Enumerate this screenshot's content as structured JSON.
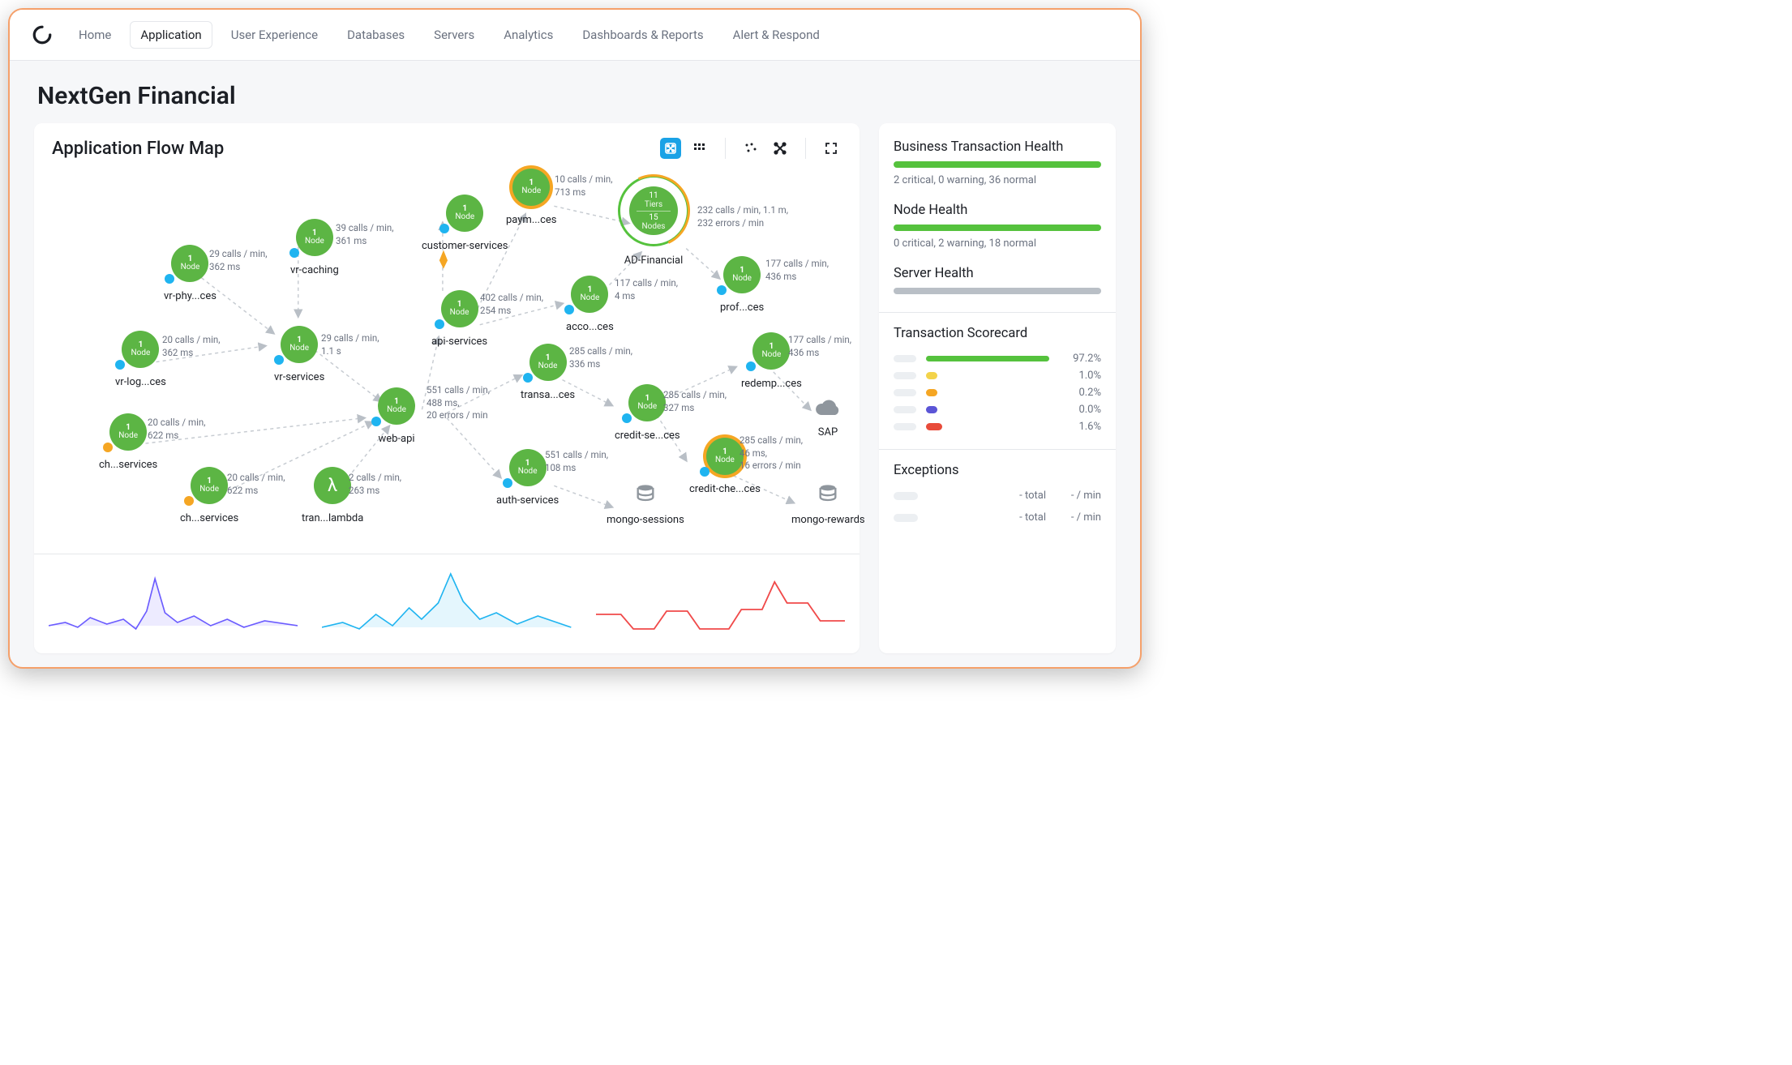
{
  "nav": {
    "items": [
      "Home",
      "Application",
      "User Experience",
      "Databases",
      "Servers",
      "Analytics",
      "Dashboards & Reports",
      "Alert & Respond"
    ],
    "activeIndex": 1
  },
  "page": {
    "title": "NextGen Financial"
  },
  "flowmap": {
    "title": "Application Flow Map",
    "cluster": {
      "label": "AD-Financial",
      "tiers": "11",
      "tiersLabel": "Tiers",
      "nodes": "15",
      "nodesLabel": "Nodes",
      "metrics": [
        "232 calls / min, 1.1 m,",
        "232 errors / min"
      ]
    },
    "nodes": [
      {
        "id": "vr-phy",
        "label": "vr-phy...ces",
        "count": "1",
        "metrics": [
          "29 calls / min,",
          "362 ms"
        ],
        "dot": "blue"
      },
      {
        "id": "vr-caching",
        "label": "vr-caching",
        "count": "1",
        "metrics": [
          "39 calls / min,",
          "361 ms"
        ],
        "dot": "blue"
      },
      {
        "id": "customer",
        "label": "customer-services",
        "count": "1",
        "metrics": [],
        "dot": "blue"
      },
      {
        "id": "paym",
        "label": "paym...ces",
        "count": "1",
        "metrics": [
          "10 calls / min,",
          "713 ms"
        ],
        "dot": "",
        "ring": true
      },
      {
        "id": "vr-log",
        "label": "vr-log...ces",
        "count": "1",
        "metrics": [
          "20 calls / min,",
          "362 ms"
        ],
        "dot": "blue"
      },
      {
        "id": "vr-serv",
        "label": "vr-services",
        "count": "1",
        "metrics": [
          "29 calls / min,",
          "1.1 s"
        ],
        "dot": "blue"
      },
      {
        "id": "api",
        "label": "api-services",
        "count": "1",
        "metrics": [
          "402 calls / min,",
          "254 ms"
        ],
        "dot": "blue"
      },
      {
        "id": "acco",
        "label": "acco...ces",
        "count": "1",
        "metrics": [
          "117 calls / min,",
          "4 ms"
        ],
        "dot": "blue"
      },
      {
        "id": "prof",
        "label": "prof...ces",
        "count": "1",
        "metrics": [
          "177 calls / min,",
          "436 ms"
        ],
        "dot": "blue"
      },
      {
        "id": "ch1",
        "label": "ch...services",
        "count": "1",
        "metrics": [
          "20 calls / min,",
          "622 ms"
        ],
        "dot": "orange"
      },
      {
        "id": "webapi",
        "label": "web-api",
        "count": "1",
        "metrics": [
          "551 calls / min,",
          "488 ms,",
          "20 errors / min"
        ],
        "dot": "blue"
      },
      {
        "id": "transa",
        "label": "transa...ces",
        "count": "1",
        "metrics": [
          "285 calls / min,",
          "336 ms"
        ],
        "dot": "blue"
      },
      {
        "id": "credit-se",
        "label": "credit-se...ces",
        "count": "1",
        "metrics": [
          "285 calls / min,",
          "327 ms"
        ],
        "dot": "blue"
      },
      {
        "id": "redemp",
        "label": "redemp...ces",
        "count": "1",
        "metrics": [
          "177 calls / min,",
          "436 ms"
        ],
        "dot": "blue"
      },
      {
        "id": "ch2",
        "label": "ch...services",
        "count": "1",
        "metrics": [
          "20 calls / min,",
          "622 ms"
        ],
        "dot": "orange"
      },
      {
        "id": "lambda",
        "label": "tran...lambda",
        "count": "λ",
        "metrics": [
          "2 calls / min,",
          "263 ms"
        ],
        "dot": "",
        "lambda": true
      },
      {
        "id": "auth",
        "label": "auth-services",
        "count": "1",
        "metrics": [
          "551 calls / min,",
          "108 ms"
        ],
        "dot": "blue"
      },
      {
        "id": "credit-che",
        "label": "credit-che...ces",
        "count": "1",
        "metrics": [
          "285 calls / min,",
          "46 ms,",
          "16 errors / min"
        ],
        "dot": "blue",
        "ring": true
      },
      {
        "id": "mongo-sess",
        "label": "mongo-sessions",
        "db": true
      },
      {
        "id": "mongo-rew",
        "label": "mongo-rewards",
        "db": true
      },
      {
        "id": "sap",
        "label": "SAP",
        "cloud": true
      }
    ]
  },
  "health": {
    "bt": {
      "title": "Business Transaction Health",
      "text": "2 critical, 0 warning, 36 normal"
    },
    "node": {
      "title": "Node Health",
      "text": "0 critical, 2 warning, 18 normal"
    },
    "server": {
      "title": "Server Health"
    }
  },
  "scorecard": {
    "title": "Transaction Scorecard",
    "rows": [
      {
        "color": "green",
        "value": "97.2%",
        "width": 100
      },
      {
        "color": "yellow",
        "value": "1.0%",
        "width": 0
      },
      {
        "color": "orange",
        "value": "0.2%",
        "width": 0
      },
      {
        "color": "purple",
        "value": "0.0%",
        "width": 0
      },
      {
        "color": "red",
        "value": "1.6%",
        "width": 0
      }
    ]
  },
  "exceptions": {
    "title": "Exceptions",
    "rows": [
      {
        "total": "- total",
        "rate": "- / min"
      },
      {
        "total": "- total",
        "rate": "- / min"
      }
    ]
  }
}
